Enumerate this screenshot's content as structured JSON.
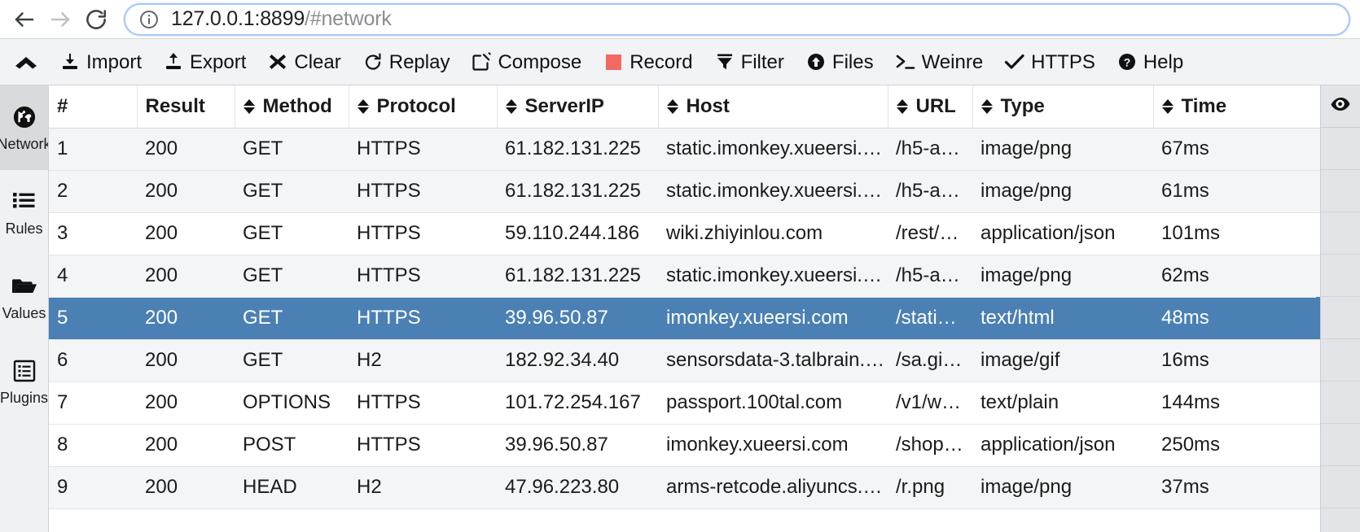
{
  "browser": {
    "back_label": "Back",
    "forward_label": "Forward",
    "reload_label": "Reload",
    "site_info_label": "Site information",
    "url_host": "127.0.0.1:8899",
    "url_path": "/#network"
  },
  "toolbar": {
    "collapse_label": "Collapse",
    "items": [
      {
        "label": "Import",
        "icon": "import-icon"
      },
      {
        "label": "Export",
        "icon": "export-icon"
      },
      {
        "label": "Clear",
        "icon": "clear-icon"
      },
      {
        "label": "Replay",
        "icon": "replay-icon"
      },
      {
        "label": "Compose",
        "icon": "compose-icon"
      },
      {
        "label": "Record",
        "icon": "record-icon"
      },
      {
        "label": "Filter",
        "icon": "filter-icon"
      },
      {
        "label": "Files",
        "icon": "files-icon"
      },
      {
        "label": "Weinre",
        "icon": "weinre-icon"
      },
      {
        "label": "HTTPS",
        "icon": "https-icon"
      },
      {
        "label": "Help",
        "icon": "help-icon"
      }
    ],
    "record_color": "#f2695f"
  },
  "sidebar": {
    "items": [
      {
        "label": "Network",
        "icon": "globe-icon",
        "active": true
      },
      {
        "label": "Rules",
        "icon": "list-icon",
        "active": false
      },
      {
        "label": "Values",
        "icon": "folder-icon",
        "active": false
      },
      {
        "label": "Plugins",
        "icon": "plugins-icon",
        "active": false
      }
    ]
  },
  "table": {
    "columns": [
      {
        "key": "num",
        "label": "#",
        "sortable": false
      },
      {
        "key": "result",
        "label": "Result",
        "sortable": true
      },
      {
        "key": "method",
        "label": "Method",
        "sortable": true
      },
      {
        "key": "protocol",
        "label": "Protocol",
        "sortable": true
      },
      {
        "key": "serverip",
        "label": "ServerIP",
        "sortable": true
      },
      {
        "key": "host",
        "label": "Host",
        "sortable": true
      },
      {
        "key": "url",
        "label": "URL",
        "sortable": true
      },
      {
        "key": "type",
        "label": "Type",
        "sortable": true
      },
      {
        "key": "time",
        "label": "Time",
        "sortable": true
      }
    ],
    "eye_column_icon": "eye-icon",
    "selected_row_color": "#4a80b4",
    "rows": [
      {
        "num": "1",
        "result": "200",
        "method": "GET",
        "protocol": "HTTPS",
        "serverip": "61.182.131.225",
        "host": "static.imonkey.xueersi.c…",
        "url": "/h5-a…",
        "type": "image/png",
        "time": "67ms",
        "style": "alt",
        "selected": false
      },
      {
        "num": "2",
        "result": "200",
        "method": "GET",
        "protocol": "HTTPS",
        "serverip": "61.182.131.225",
        "host": "static.imonkey.xueersi.c…",
        "url": "/h5-a…",
        "type": "image/png",
        "time": "61ms",
        "style": "alt",
        "selected": false
      },
      {
        "num": "3",
        "result": "200",
        "method": "GET",
        "protocol": "HTTPS",
        "serverip": "59.110.244.186",
        "host": "wiki.zhiyinlou.com",
        "url": "/rest/…",
        "type": "application/json",
        "time": "101ms",
        "style": "plain",
        "selected": false
      },
      {
        "num": "4",
        "result": "200",
        "method": "GET",
        "protocol": "HTTPS",
        "serverip": "61.182.131.225",
        "host": "static.imonkey.xueersi.c…",
        "url": "/h5-a…",
        "type": "image/png",
        "time": "62ms",
        "style": "alt",
        "selected": false
      },
      {
        "num": "5",
        "result": "200",
        "method": "GET",
        "protocol": "HTTPS",
        "serverip": "39.96.50.87",
        "host": "imonkey.xueersi.com",
        "url": "/stati…",
        "type": "text/html",
        "time": "48ms",
        "style": "selected",
        "selected": true
      },
      {
        "num": "6",
        "result": "200",
        "method": "GET",
        "protocol": "H2",
        "serverip": "182.92.34.40",
        "host": "sensorsdata-3.talbrain.c…",
        "url": "/sa.gi…",
        "type": "image/gif",
        "time": "16ms",
        "style": "alt",
        "selected": false
      },
      {
        "num": "7",
        "result": "200",
        "method": "OPTIONS",
        "protocol": "HTTPS",
        "serverip": "101.72.254.167",
        "host": "passport.100tal.com",
        "url": "/v1/w…",
        "type": "text/plain",
        "time": "144ms",
        "style": "plain",
        "selected": false
      },
      {
        "num": "8",
        "result": "200",
        "method": "POST",
        "protocol": "HTTPS",
        "serverip": "39.96.50.87",
        "host": "imonkey.xueersi.com",
        "url": "/shop…",
        "type": "application/json",
        "time": "250ms",
        "style": "plain",
        "selected": false
      },
      {
        "num": "9",
        "result": "200",
        "method": "HEAD",
        "protocol": "H2",
        "serverip": "47.96.223.80",
        "host": "arms-retcode.aliyuncs.c…",
        "url": "/r.png",
        "type": "image/png",
        "time": "37ms",
        "style": "alt",
        "selected": false
      }
    ]
  }
}
